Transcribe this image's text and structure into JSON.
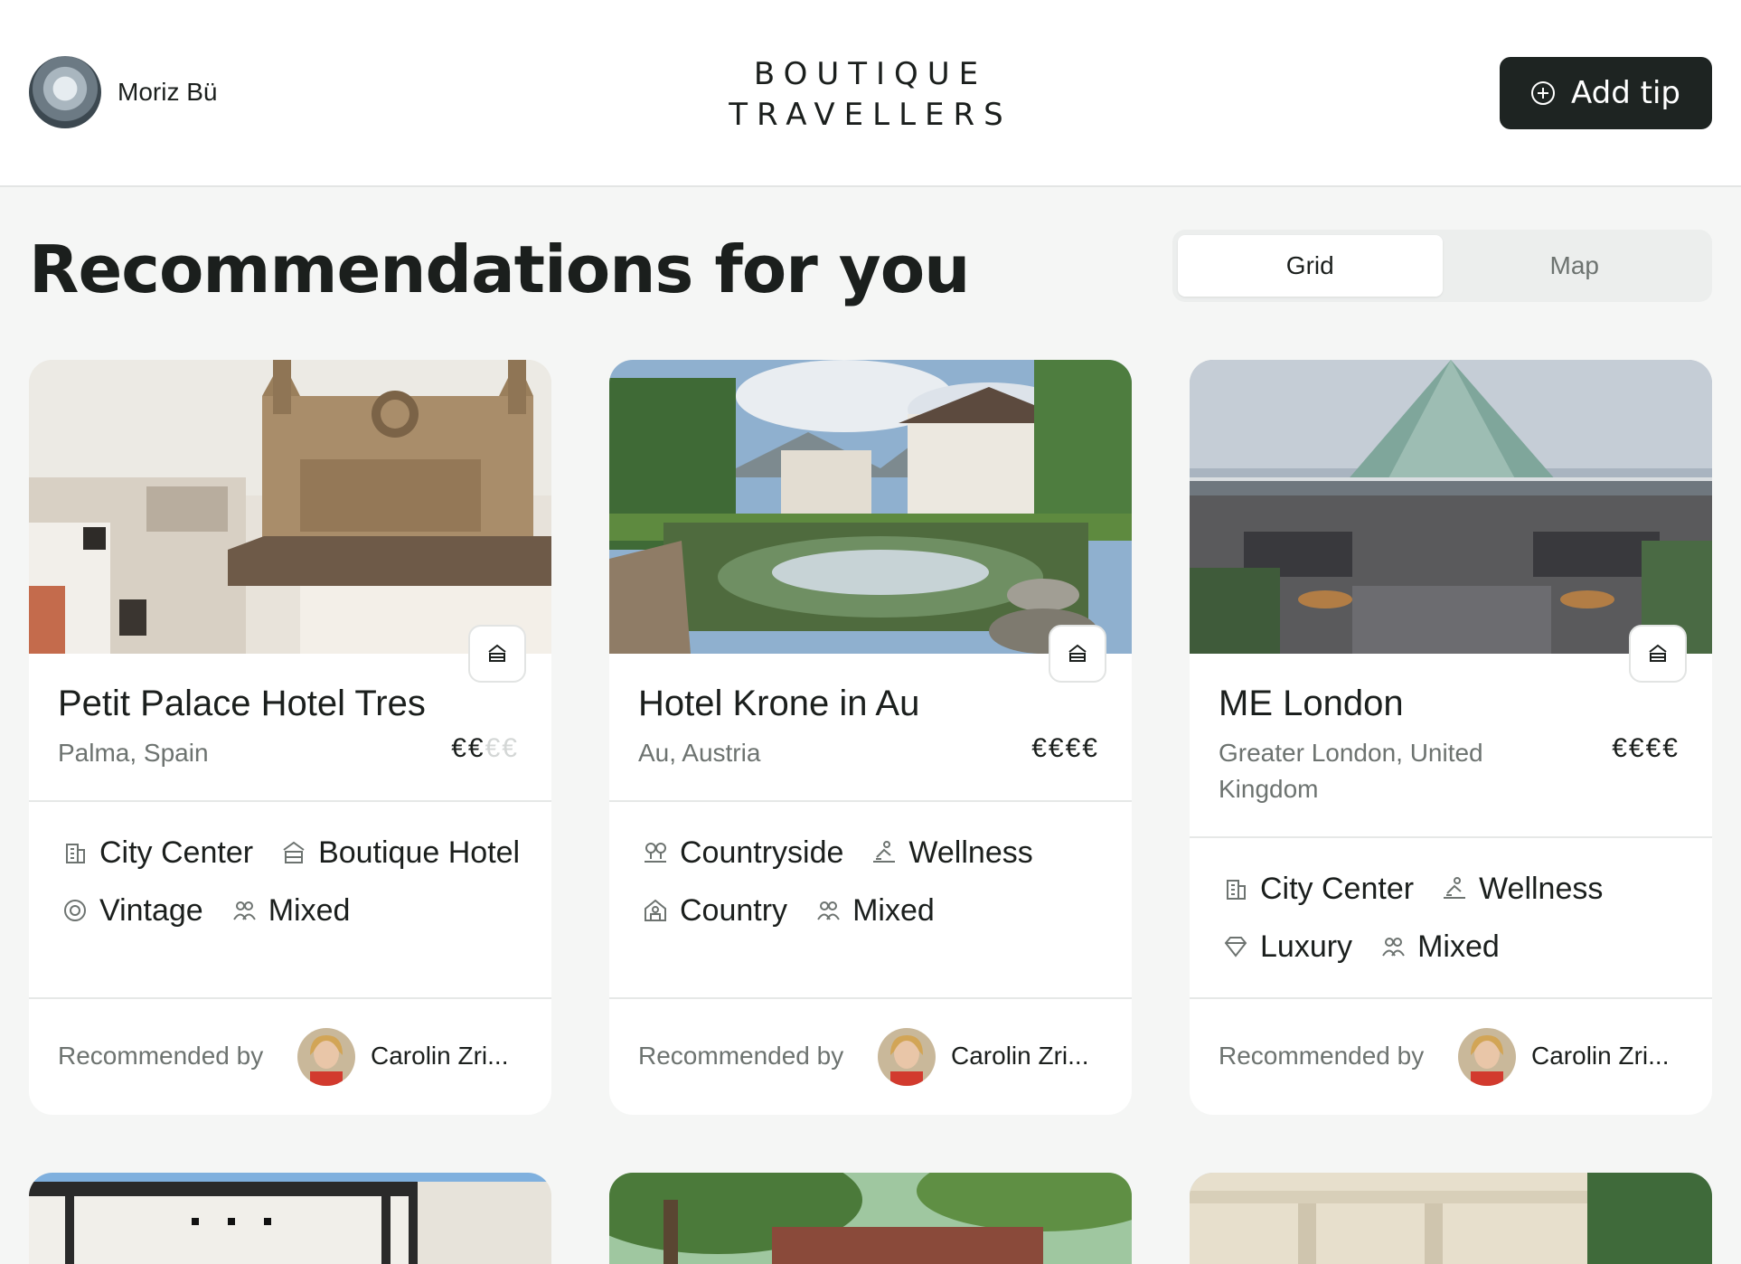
{
  "header": {
    "user_name": "Moriz Bü",
    "logo_line1": "BOUTIQUE",
    "logo_line2": "TRAVELLERS",
    "add_tip_label": "Add tip"
  },
  "main": {
    "title": "Recommendations for you",
    "view_toggle": {
      "grid_label": "Grid",
      "map_label": "Map",
      "selected": "Grid"
    }
  },
  "cards": [
    {
      "name": "Petit Palace Hotel Tres",
      "location": "Palma, Spain",
      "price_active": "€€",
      "price_inactive": "€€",
      "tags": [
        {
          "icon": "building-icon",
          "label": "City Center"
        },
        {
          "icon": "boutique-hotel-icon",
          "label": "Boutique Hotel"
        },
        {
          "icon": "vintage-icon",
          "label": "Vintage"
        },
        {
          "icon": "people-icon",
          "label": "Mixed"
        }
      ],
      "recommended_label": "Recommended by",
      "recommender": "Carolin Zri..."
    },
    {
      "name": "Hotel Krone in Au",
      "location": "Au, Austria",
      "price_active": "€€€€",
      "price_inactive": "",
      "tags": [
        {
          "icon": "countryside-icon",
          "label": "Countryside"
        },
        {
          "icon": "wellness-icon",
          "label": "Wellness"
        },
        {
          "icon": "barn-icon",
          "label": "Country"
        },
        {
          "icon": "people-icon",
          "label": "Mixed"
        }
      ],
      "recommended_label": "Recommended by",
      "recommender": "Carolin Zri..."
    },
    {
      "name": "ME London",
      "location": "Greater London, United Kingdom",
      "price_active": "€€€€",
      "price_inactive": "",
      "tags": [
        {
          "icon": "building-icon",
          "label": "City Center"
        },
        {
          "icon": "wellness-icon",
          "label": "Wellness"
        },
        {
          "icon": "diamond-icon",
          "label": "Luxury"
        },
        {
          "icon": "people-icon",
          "label": "Mixed"
        }
      ],
      "recommended_label": "Recommended by",
      "recommender": "Carolin Zri..."
    }
  ],
  "colors": {
    "background": "#f5f6f5",
    "card": "#ffffff",
    "primary_button": "#1e2422",
    "muted_text": "#6d7370",
    "text": "#1b1f1d"
  }
}
